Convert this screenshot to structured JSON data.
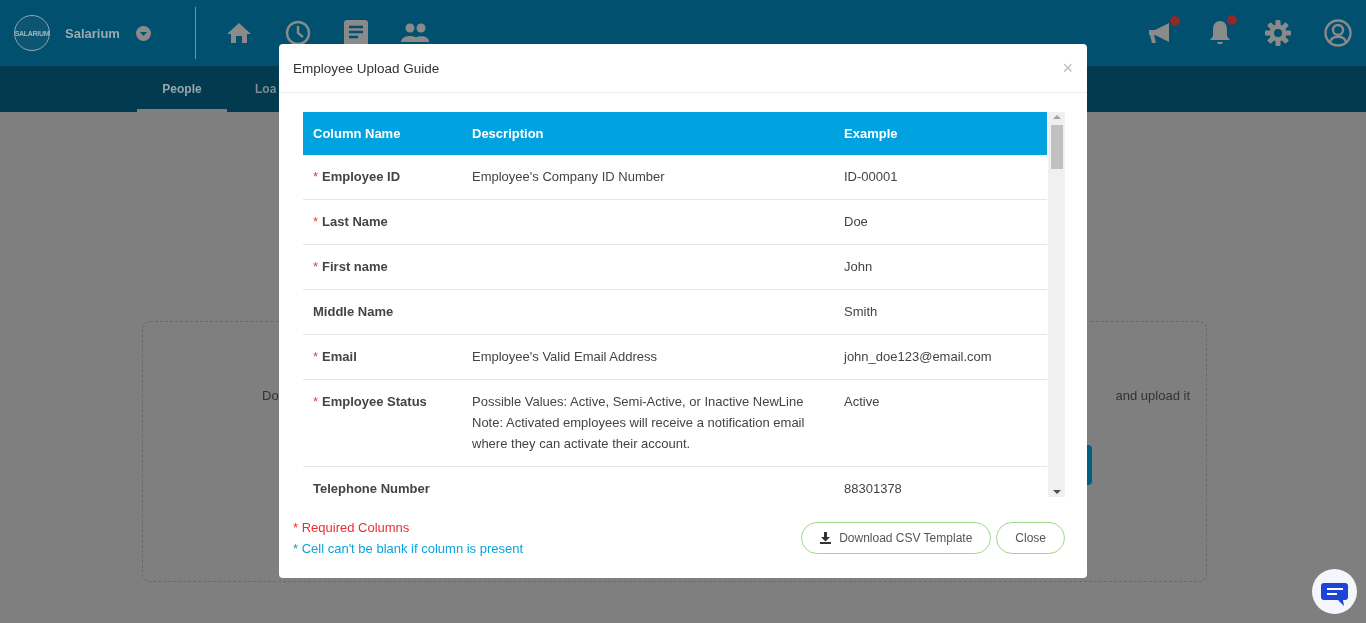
{
  "header": {
    "logo_text": "SALARIUM",
    "company": "Salarium",
    "nav_icons": [
      {
        "kind": "home"
      },
      {
        "kind": "clock"
      },
      {
        "kind": "document"
      },
      {
        "kind": "people"
      }
    ],
    "tools": [
      {
        "kind": "megaphone",
        "badge": true
      },
      {
        "kind": "bell",
        "badge": true
      },
      {
        "kind": "gear",
        "badge": false
      },
      {
        "kind": "user",
        "badge": false
      }
    ]
  },
  "subnav": {
    "tabs": [
      {
        "label": "People",
        "selected": true
      },
      {
        "label": "Loa",
        "selected": false
      }
    ]
  },
  "page": {
    "text_left": "Do",
    "text_right": "and upload it"
  },
  "modal": {
    "title": "Employee Upload Guide",
    "close": "×",
    "table": {
      "columns": [
        "Column Name",
        "Description",
        "Example"
      ],
      "rows": [
        {
          "mark": "*",
          "name": "Employee ID",
          "description": "Employee's Company ID Number",
          "example": "ID-00001"
        },
        {
          "mark": "*",
          "name": "Last Name",
          "description": "",
          "example": "Doe"
        },
        {
          "mark": "*",
          "name": "First name",
          "description": "",
          "example": "John"
        },
        {
          "name": "Middle Name",
          "description": "",
          "example": "Smith"
        },
        {
          "mark": "*",
          "name": "Email",
          "description": "Employee's Valid Email Address",
          "example": "john_doe123@email.com"
        },
        {
          "mark": "*",
          "name": "Employee Status",
          "description": "Possible Values: Active, Semi-Active, or Inactive NewLine Note: Activated employees will receive a notification email where they can activate their account.",
          "example": "Active"
        },
        {
          "name": "Telephone Number",
          "description": "",
          "example": "88301378"
        }
      ]
    },
    "legend": [
      {
        "kind": "required",
        "text": "* Required Columns"
      },
      {
        "kind": "conditional",
        "text": "* Cell can't be blank if column is present"
      }
    ],
    "buttons": [
      {
        "kind": "download",
        "label": "Download CSV Template"
      },
      {
        "kind": "plain",
        "label": "Close"
      }
    ]
  }
}
